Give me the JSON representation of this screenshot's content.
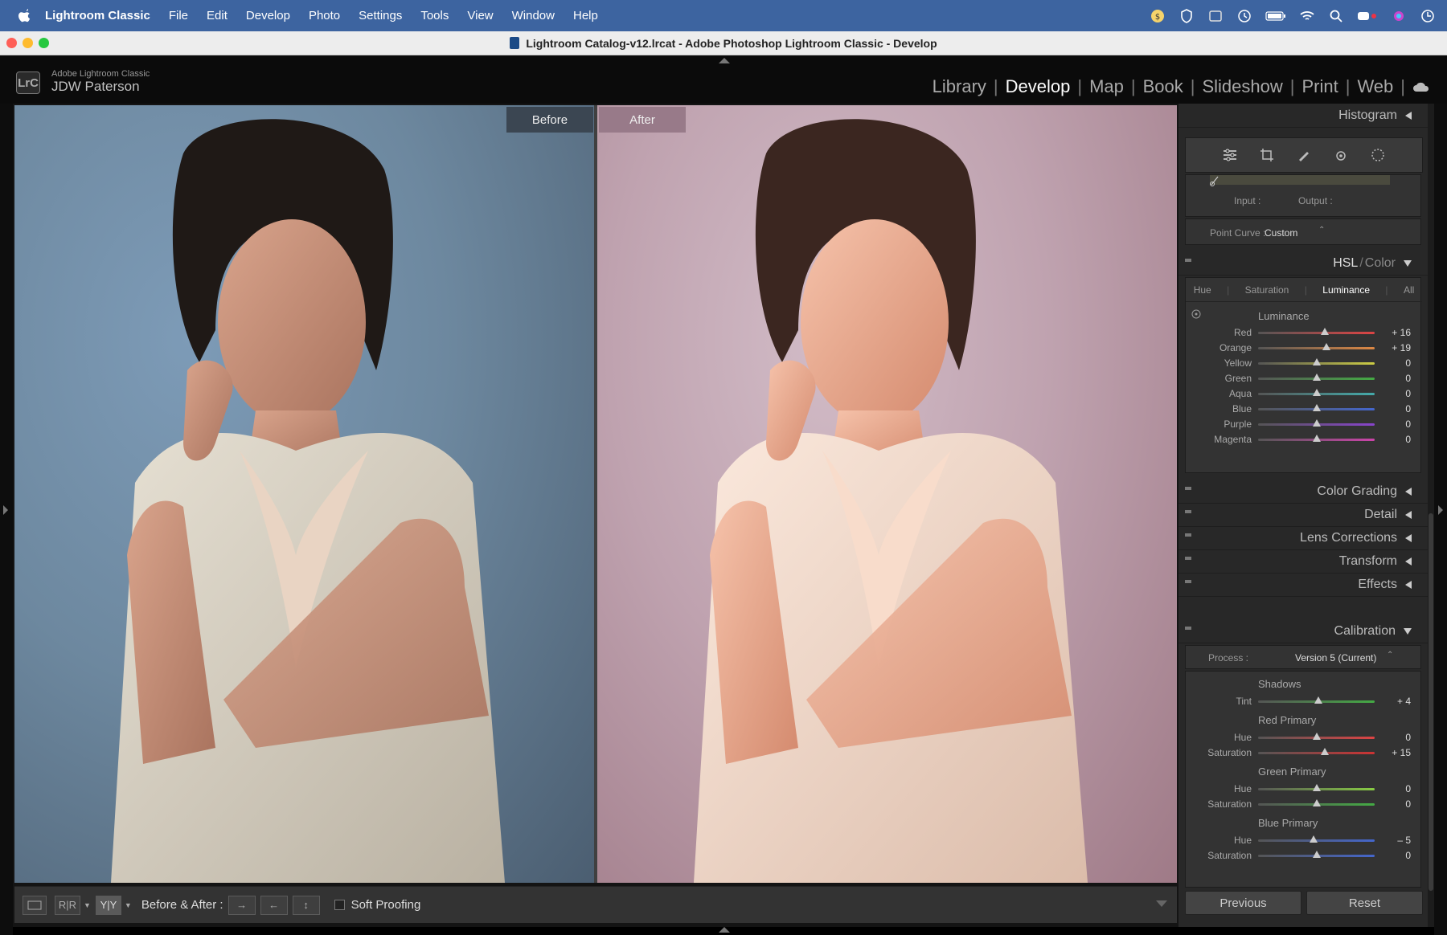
{
  "menubar": {
    "app_name": "Lightroom Classic",
    "items": [
      "File",
      "Edit",
      "Develop",
      "Photo",
      "Settings",
      "Tools",
      "View",
      "Window",
      "Help"
    ]
  },
  "window": {
    "title": "Lightroom Catalog-v12.lrcat - Adobe Photoshop Lightroom Classic - Develop"
  },
  "identity": {
    "badge": "LrC",
    "product": "Adobe Lightroom Classic",
    "user": "JDW Paterson"
  },
  "modules": {
    "items": [
      "Library",
      "Develop",
      "Map",
      "Book",
      "Slideshow",
      "Print",
      "Web"
    ],
    "active": "Develop"
  },
  "view": {
    "before_label": "Before",
    "after_label": "After"
  },
  "toolbar": {
    "before_after_label": "Before & After :",
    "soft_proofing_label": "Soft Proofing",
    "view_mode_rr": "R|R",
    "view_mode_yy": "Y|Y"
  },
  "right_panel": {
    "histogram": "Histogram",
    "tone_curve": {
      "input_label": "Input :",
      "output_label": "Output :",
      "point_curve_label": "Point Curve :",
      "point_curve_value": "Custom"
    },
    "hsl": {
      "title_hsl": "HSL",
      "title_color": "Color",
      "tabs": [
        "Hue",
        "Saturation",
        "Luminance",
        "All"
      ],
      "active_tab": "Luminance",
      "section_title": "Luminance",
      "sliders": [
        {
          "name": "Red",
          "value": "+ 16",
          "pos": 0.57,
          "color": "#d44"
        },
        {
          "name": "Orange",
          "value": "+ 19",
          "pos": 0.585,
          "color": "#d84"
        },
        {
          "name": "Yellow",
          "value": "0",
          "pos": 0.5,
          "color": "#cc4"
        },
        {
          "name": "Green",
          "value": "0",
          "pos": 0.5,
          "color": "#4a4"
        },
        {
          "name": "Aqua",
          "value": "0",
          "pos": 0.5,
          "color": "#4aa"
        },
        {
          "name": "Blue",
          "value": "0",
          "pos": 0.5,
          "color": "#46c"
        },
        {
          "name": "Purple",
          "value": "0",
          "pos": 0.5,
          "color": "#84c"
        },
        {
          "name": "Magenta",
          "value": "0",
          "pos": 0.5,
          "color": "#c4a"
        }
      ]
    },
    "collapsed_panels": [
      "Color Grading",
      "Detail",
      "Lens Corrections",
      "Transform",
      "Effects"
    ],
    "calibration": {
      "title": "Calibration",
      "process_label": "Process :",
      "process_value": "Version 5 (Current)",
      "groups": [
        {
          "title": "Shadows",
          "sliders": [
            {
              "name": "Tint",
              "value": "+ 4",
              "pos": 0.52,
              "color": "#4a4"
            }
          ]
        },
        {
          "title": "Red Primary",
          "sliders": [
            {
              "name": "Hue",
              "value": "0",
              "pos": 0.5,
              "color": "#d44"
            },
            {
              "name": "Saturation",
              "value": "+ 15",
              "pos": 0.575,
              "color": "#c33"
            }
          ]
        },
        {
          "title": "Green Primary",
          "sliders": [
            {
              "name": "Hue",
              "value": "0",
              "pos": 0.5,
              "color": "#8c4"
            },
            {
              "name": "Saturation",
              "value": "0",
              "pos": 0.5,
              "color": "#4a4"
            }
          ]
        },
        {
          "title": "Blue Primary",
          "sliders": [
            {
              "name": "Hue",
              "value": "– 5",
              "pos": 0.475,
              "color": "#46c"
            },
            {
              "name": "Saturation",
              "value": "0",
              "pos": 0.5,
              "color": "#46c"
            }
          ]
        }
      ]
    },
    "buttons": {
      "previous": "Previous",
      "reset": "Reset"
    }
  }
}
